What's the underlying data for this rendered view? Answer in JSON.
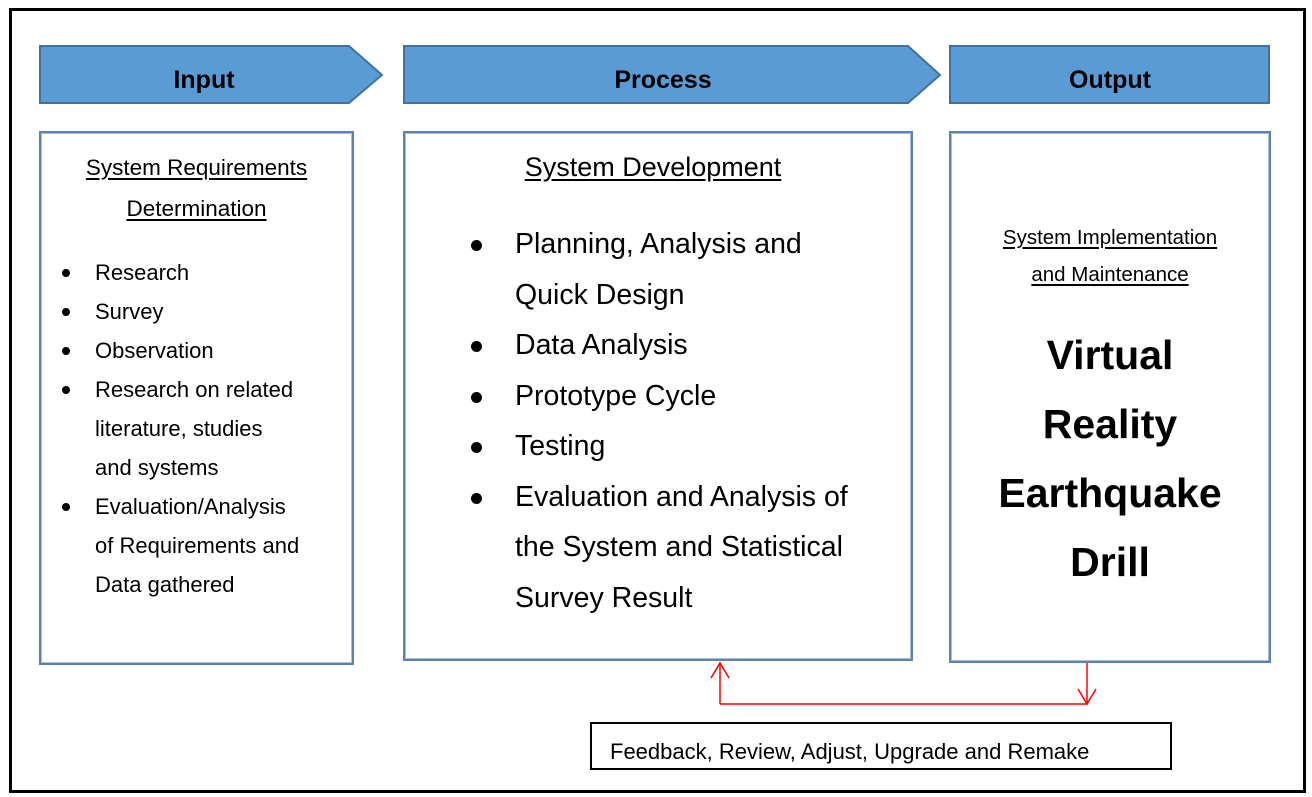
{
  "colors": {
    "chevron_fill": "#5b9bd5",
    "chevron_stroke": "#41719c",
    "panel_border": "#5b80b2",
    "connector": "#ff0000",
    "frame": "#000000"
  },
  "stages": {
    "input": {
      "label": "Input",
      "title_line1": "System Requirements",
      "title_line2": "Determination",
      "items": [
        {
          "lines": [
            "Research"
          ]
        },
        {
          "lines": [
            "Survey"
          ]
        },
        {
          "lines": [
            "Observation"
          ]
        },
        {
          "lines": [
            "Research on related",
            "literature, studies",
            "and systems"
          ]
        },
        {
          "lines": [
            "Evaluation/Analysis",
            "of Requirements and",
            "Data gathered"
          ]
        }
      ]
    },
    "process": {
      "label": "Process",
      "title": "System Development",
      "items": [
        {
          "lines": [
            "Planning, Analysis and",
            "Quick Design"
          ]
        },
        {
          "lines": [
            "Data Analysis"
          ]
        },
        {
          "lines": [
            "Prototype Cycle"
          ]
        },
        {
          "lines": [
            "Testing"
          ]
        },
        {
          "lines": [
            "Evaluation and Analysis of",
            "the System and Statistical",
            "Survey Result"
          ]
        }
      ]
    },
    "output": {
      "label": "Output",
      "title_line1": "System Implementation",
      "title_line2": "and Maintenance",
      "product_lines": [
        "Virtual",
        "Reality",
        "Earthquake",
        "Drill"
      ]
    }
  },
  "feedback": {
    "label": "Feedback, Review, Adjust, Upgrade and Remake",
    "arrow_from": "output",
    "arrow_to": "process"
  }
}
